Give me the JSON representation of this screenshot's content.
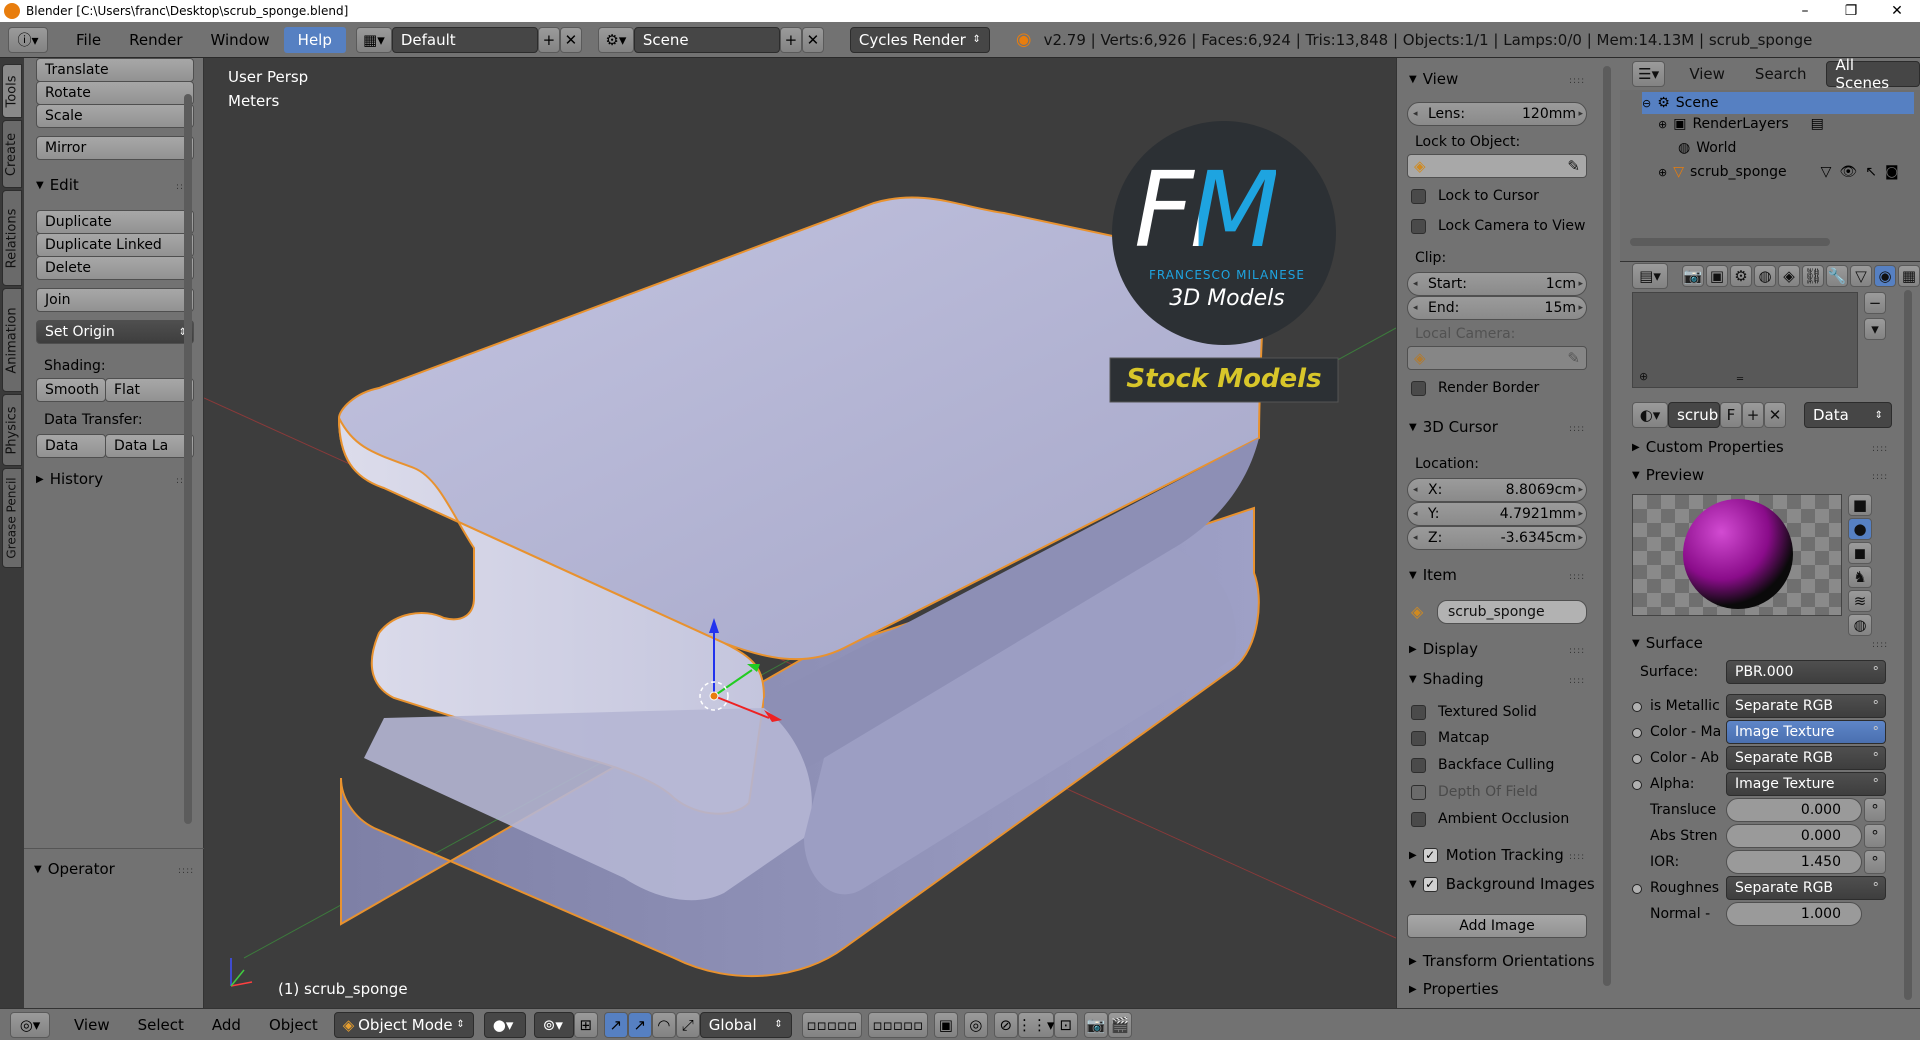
{
  "window": {
    "title": "Blender [C:\\Users\\franc\\Desktop\\scrub_sponge.blend]",
    "minimize": "–",
    "maximize": "❐",
    "close": "✕"
  },
  "info_header": {
    "menus": [
      "File",
      "Render",
      "Window",
      "Help"
    ],
    "active_menu": "Help",
    "screen_layout": "Default",
    "scene": "Scene",
    "render_engine": "Cycles Render",
    "stats": "v2.79 | Verts:6,926 | Faces:6,924 | Tris:13,848 | Objects:1/1 | Lamps:0/0 | Mem:14.13M | scrub_sponge"
  },
  "left_tabs": [
    "Tools",
    "Create",
    "Relations",
    "Animation",
    "Physics",
    "Grease Pencil"
  ],
  "toolshelf": {
    "transform": [
      "Translate",
      "Rotate",
      "Scale"
    ],
    "mirror": "Mirror",
    "edit_header": "Edit",
    "edit": [
      "Duplicate",
      "Duplicate Linked",
      "Delete"
    ],
    "join": "Join",
    "set_origin": "Set Origin",
    "shading_label": "Shading:",
    "smooth": "Smooth",
    "flat": "Flat",
    "data_transfer_label": "Data Transfer:",
    "data": "Data",
    "data_layers": "Data La",
    "history_header": "History",
    "operator_header": "Operator"
  },
  "viewport": {
    "view_name": "User Persp",
    "units": "Meters",
    "object_label": "(1) scrub_sponge",
    "watermark_fm": "FM",
    "watermark_name": "FRANCESCO MILANESE",
    "watermark_sub": "3D Models",
    "watermark_banner": "Stock Models",
    "colors": {
      "mesh": "#b6b8d6",
      "outline": "#e8922f",
      "background": "#3d3d3d"
    }
  },
  "npanel": {
    "view_header": "View",
    "lens_label": "Lens:",
    "lens_value": "120mm",
    "lock_to_object": "Lock to Object:",
    "lock_to_cursor": "Lock to Cursor",
    "lock_camera": "Lock Camera to View",
    "clip_label": "Clip:",
    "clip_start_label": "Start:",
    "clip_start": "1cm",
    "clip_end_label": "End:",
    "clip_end": "15m",
    "local_camera": "Local Camera:",
    "render_border": "Render Border",
    "cursor_header": "3D Cursor",
    "location_label": "Location:",
    "x_label": "X:",
    "x_value": "8.8069cm",
    "y_label": "Y:",
    "y_value": "4.7921mm",
    "z_label": "Z:",
    "z_value": "-3.6345cm",
    "item_header": "Item",
    "item_name": "scrub_sponge",
    "display_header": "Display",
    "shading_header": "Shading",
    "textured_solid": "Textured Solid",
    "matcap": "Matcap",
    "backface_culling": "Backface Culling",
    "depth_of_field": "Depth Of Field",
    "ambient_occlusion": "Ambient Occlusion",
    "motion_tracking": "Motion Tracking",
    "background_images": "Background Images",
    "add_image": "Add Image",
    "transform_orientations": "Transform Orientations",
    "properties": "Properties"
  },
  "outliner": {
    "view": "View",
    "search": "Search",
    "filter": "All Scenes",
    "items": [
      "Scene",
      "RenderLayers",
      "World",
      "scrub_sponge"
    ]
  },
  "properties": {
    "material_name": "scrub",
    "fake_user": "F",
    "link": "Data",
    "custom_properties": "Custom Properties",
    "preview": "Preview",
    "surface_header": "Surface",
    "surface_label": "Surface:",
    "surface_value": "PBR.000",
    "is_metallic_label": "is Metallic",
    "is_metallic_value": "Separate RGB",
    "color_ma_label": "Color - Ma",
    "color_ma_value": "Image Texture",
    "color_ab_label": "Color - Ab",
    "color_ab_value": "Separate RGB",
    "alpha_label": "Alpha:",
    "alpha_value": "Image Texture",
    "translucency_label": "Transluce",
    "translucency_value": "0.000",
    "abs_strength_label": "Abs Stren",
    "abs_strength_value": "0.000",
    "ior_label": "IOR:",
    "ior_value": "1.450",
    "roughness_label": "Roughnes",
    "roughness_value": "Separate RGB",
    "normal_label": "Normal -",
    "normal_value": "1.000"
  },
  "bottom_header": {
    "menus": [
      "View",
      "Select",
      "Add",
      "Object"
    ],
    "mode": "Object Mode",
    "orientation": "Global"
  }
}
